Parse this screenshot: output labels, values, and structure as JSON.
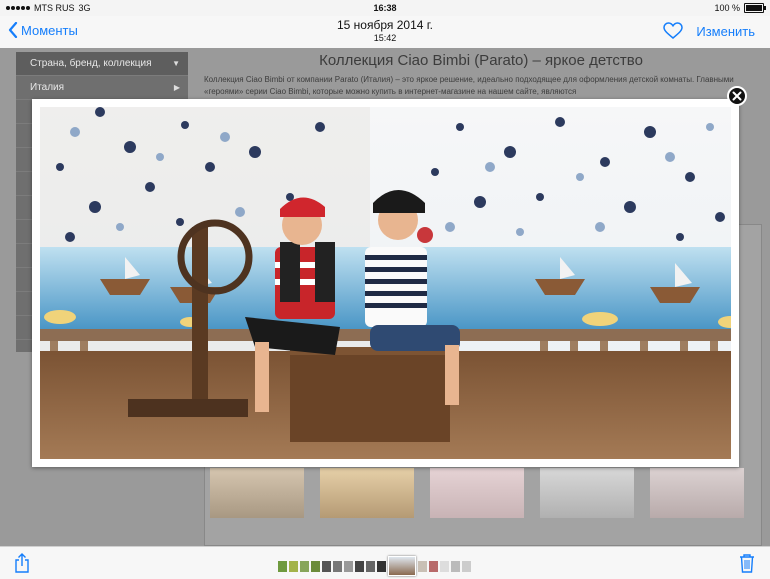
{
  "status": {
    "carrier": "MTS RUS",
    "network": "3G",
    "time": "16:38",
    "battery_text": "100 %",
    "battery_level": 1.0
  },
  "nav": {
    "back_label": "Моменты",
    "title": "15 ноября 2014 г.",
    "subtitle": "15:42",
    "edit_label": "Изменить"
  },
  "page": {
    "heading": "Коллекция Ciao Bimbi (Parato) – яркое детство",
    "description": "Коллекция Ciao Bimbi от компании Parato (Италия) – это яркое решение, идеально подходящее для оформления детской комнаты. Главными «героями» серии Ciao Bimbi, которые можно купить в интернет-магазине на нашем сайте, являются",
    "sidebar": [
      {
        "label": "Страна, бренд, коллекция"
      },
      {
        "label": "Италия"
      }
    ]
  },
  "colors": {
    "accent": "#157efb",
    "dim_overlay": "#9a9a9a"
  },
  "icons": {
    "back": "chevron-left-icon",
    "favorite": "heart-icon",
    "close": "close-icon",
    "share": "share-icon",
    "delete": "trash-icon"
  }
}
